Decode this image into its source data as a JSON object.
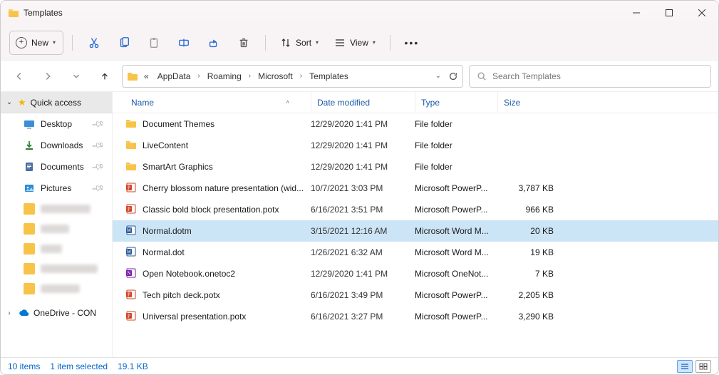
{
  "window": {
    "title": "Templates"
  },
  "toolbar": {
    "new_label": "New",
    "sort_label": "Sort",
    "view_label": "View"
  },
  "breadcrumbs": {
    "prefix": "«",
    "appdata": "AppData",
    "roaming": "Roaming",
    "microsoft": "Microsoft",
    "templates": "Templates"
  },
  "search": {
    "placeholder": "Search Templates"
  },
  "sidebar": {
    "quick_access": "Quick access",
    "items": [
      {
        "label": "Desktop"
      },
      {
        "label": "Downloads"
      },
      {
        "label": "Documents"
      },
      {
        "label": "Pictures"
      }
    ],
    "onedrive": "OneDrive - CON"
  },
  "columns": {
    "name": "Name",
    "date": "Date modified",
    "type": "Type",
    "size": "Size"
  },
  "files": [
    {
      "icon": "folder",
      "name": "Document Themes",
      "date": "12/29/2020 1:41 PM",
      "type": "File folder",
      "size": ""
    },
    {
      "icon": "folder",
      "name": "LiveContent",
      "date": "12/29/2020 1:41 PM",
      "type": "File folder",
      "size": ""
    },
    {
      "icon": "folder",
      "name": "SmartArt Graphics",
      "date": "12/29/2020 1:41 PM",
      "type": "File folder",
      "size": ""
    },
    {
      "icon": "ppt",
      "name": "Cherry blossom nature presentation (wid...",
      "date": "10/7/2021 3:03 PM",
      "type": "Microsoft PowerP...",
      "size": "3,787 KB"
    },
    {
      "icon": "ppt",
      "name": "Classic bold block presentation.potx",
      "date": "6/16/2021 3:51 PM",
      "type": "Microsoft PowerP...",
      "size": "966 KB"
    },
    {
      "icon": "word",
      "name": "Normal.dotm",
      "date": "3/15/2021 12:16 AM",
      "type": "Microsoft Word M...",
      "size": "20 KB",
      "selected": true
    },
    {
      "icon": "word",
      "name": "Normal.dot",
      "date": "1/26/2021 6:32 AM",
      "type": "Microsoft Word M...",
      "size": "19 KB"
    },
    {
      "icon": "onenote",
      "name": "Open Notebook.onetoc2",
      "date": "12/29/2020 1:41 PM",
      "type": "Microsoft OneNot...",
      "size": "7 KB"
    },
    {
      "icon": "ppt",
      "name": "Tech pitch deck.potx",
      "date": "6/16/2021 3:49 PM",
      "type": "Microsoft PowerP...",
      "size": "2,205 KB"
    },
    {
      "icon": "ppt",
      "name": "Universal presentation.potx",
      "date": "6/16/2021 3:27 PM",
      "type": "Microsoft PowerP...",
      "size": "3,290 KB"
    }
  ],
  "status": {
    "items": "10 items",
    "selected": "1 item selected",
    "size": "19.1 KB"
  }
}
